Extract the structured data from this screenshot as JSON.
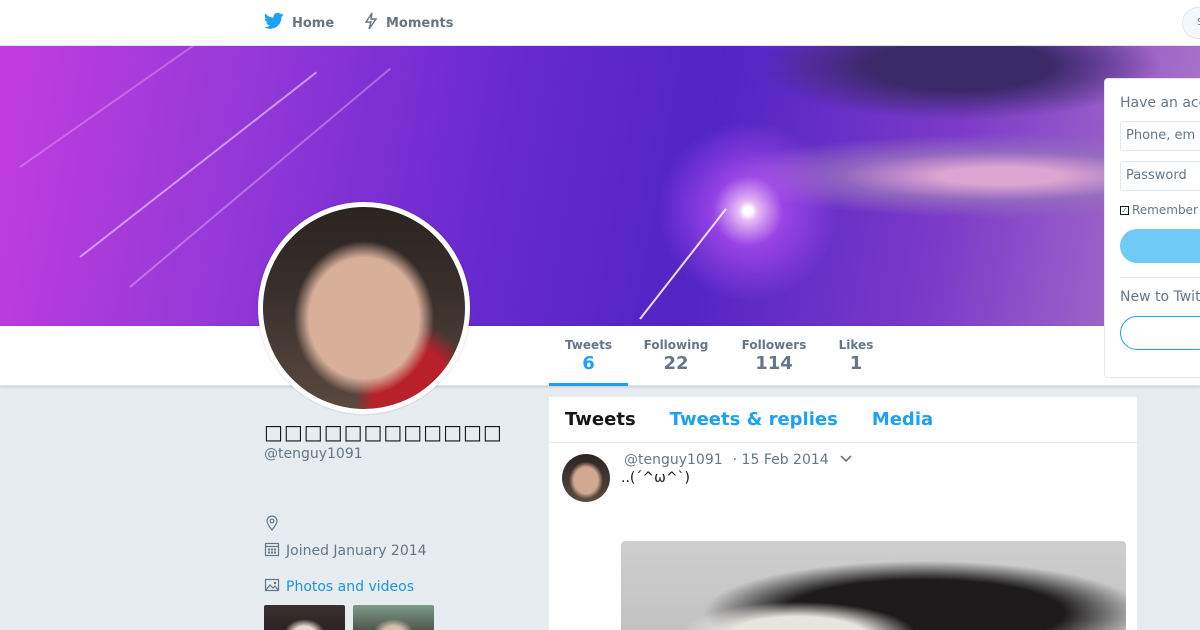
{
  "nav": {
    "home_label": "Home",
    "moments_label": "Moments",
    "search_placeholder": "S"
  },
  "stats": [
    {
      "label": "Tweets",
      "value": "6"
    },
    {
      "label": "Following",
      "value": "22"
    },
    {
      "label": "Followers",
      "value": "114"
    },
    {
      "label": "Likes",
      "value": "1"
    }
  ],
  "profile": {
    "name": "□□□□□□□□□□□□",
    "handle": "@tenguy1091",
    "joined": "Joined January 2014",
    "photos_label": "Photos and videos"
  },
  "timeline": {
    "tabs": [
      "Tweets",
      "Tweets & replies",
      "Media"
    ],
    "tweet": {
      "handle": "@tenguy1091",
      "date": "· 15 Feb 2014",
      "text": "..(´^ω^`)"
    }
  },
  "login": {
    "title": "Have an acc",
    "phone_placeholder": "Phone, em",
    "password_placeholder": "Password",
    "remember_label": "Remember",
    "new_to": "New to Twitt"
  },
  "colors": {
    "accent": "#1da1f2",
    "background": "#e6ecf0",
    "muted": "#657786"
  },
  "icons": [
    "twitter-bird-icon",
    "lightning-icon",
    "location-icon",
    "calendar-icon",
    "image-icon",
    "chevron-down-icon"
  ]
}
